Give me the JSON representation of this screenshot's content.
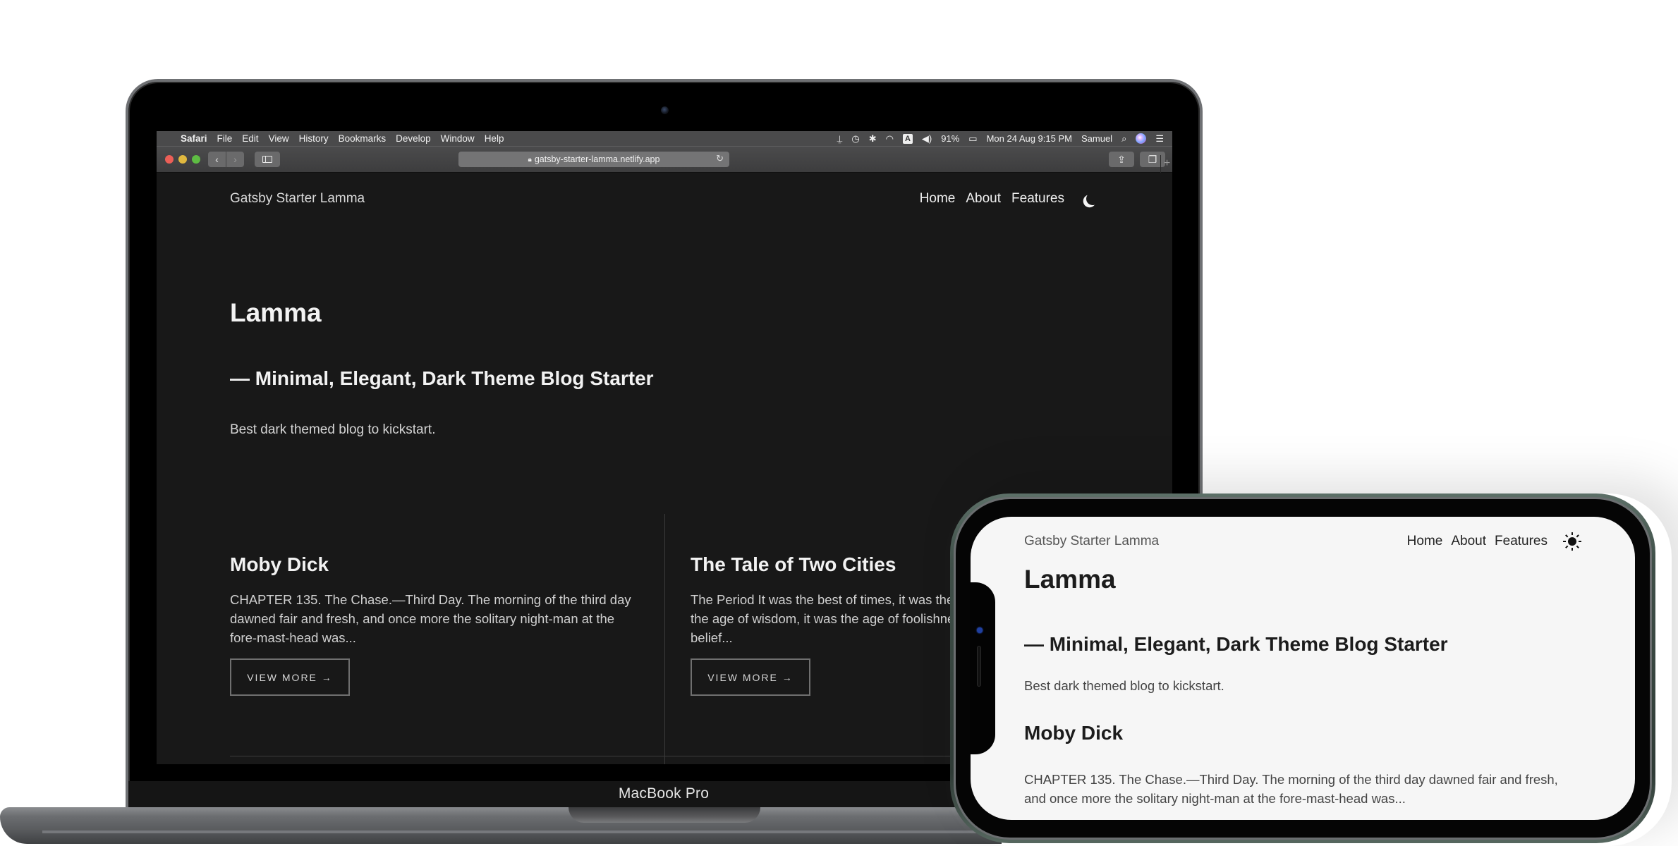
{
  "devices": {
    "laptop_brand": "MacBook Pro"
  },
  "macos_menubar": {
    "apple_icon": "apple-logo-icon",
    "app_name": "Safari",
    "menus": [
      "File",
      "Edit",
      "View",
      "History",
      "Bookmarks",
      "Develop",
      "Window",
      "Help"
    ],
    "status": {
      "input_source": "A",
      "battery": "91%",
      "datetime": "Mon 24 Aug  9:15 PM",
      "user": "Samuel"
    }
  },
  "safari": {
    "url": "gatsby-starter-lamma.netlify.app",
    "new_tab_label": "+"
  },
  "site": {
    "brand": "Gatsby Starter Lamma",
    "nav": [
      "Home",
      "About",
      "Features"
    ],
    "title": "Lamma",
    "subtitle": "— Minimal, Elegant, Dark Theme Blog Starter",
    "description": "Best dark themed blog to kickstart.",
    "posts": [
      {
        "title": "Moby Dick",
        "excerpt": "CHAPTER 135. The Chase.—Third Day. The morning of the third day dawned fair and fresh, and once more the solitary night-man at the fore-mast-head was...",
        "button": "VIEW MORE →"
      },
      {
        "title": "The Tale of Two Cities",
        "excerpt": "The Period It was the best of times, it was the worst of times, it was the age of wisdom, it was the age of foolishness, it was the epoch of belief...",
        "button": "VIEW MORE →"
      }
    ],
    "theme_toggle_dark": "moon-icon",
    "theme_toggle_light": "sun-icon"
  },
  "colors": {
    "dark_bg": "#181818",
    "light_bg": "#f6f6f6",
    "phone_frame": "#3f4f48"
  }
}
